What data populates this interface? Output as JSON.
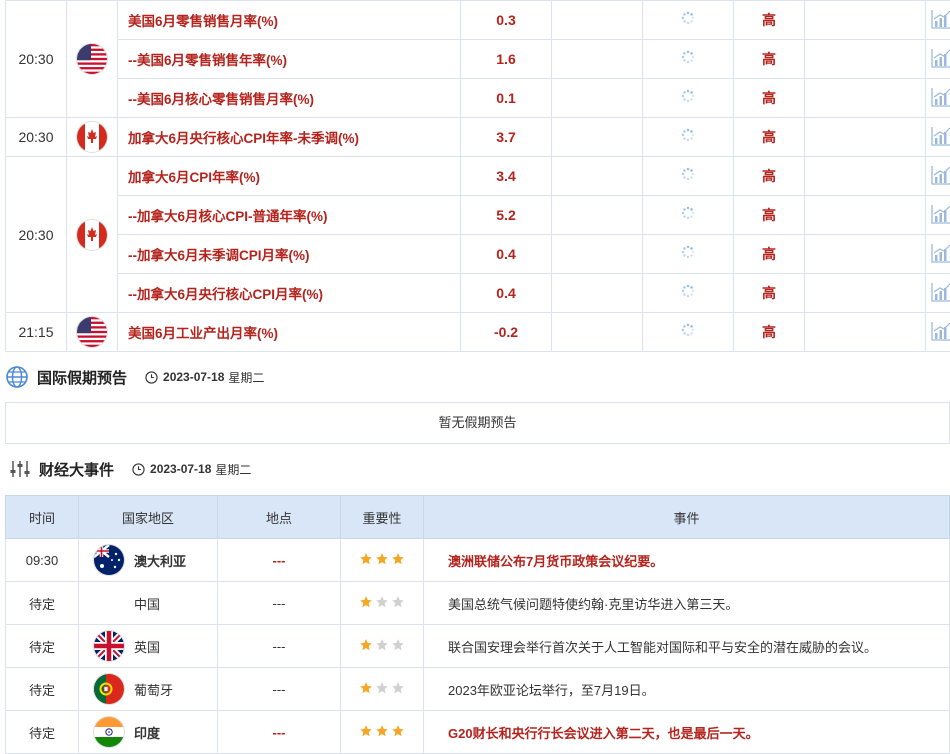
{
  "calendar": {
    "groups": [
      {
        "time": "20:30",
        "flag": "us-flag-icon",
        "rows": [
          {
            "event": "美国6月零售销售月率(%)",
            "value": "0.3",
            "importance": "高"
          },
          {
            "event": "--美国6月零售销售年率(%)",
            "value": "1.6",
            "importance": "高"
          },
          {
            "event": "--美国6月核心零售销售月率(%)",
            "value": "0.1",
            "importance": "高"
          }
        ]
      },
      {
        "time": "20:30",
        "flag": "ca-flag-icon",
        "rows": [
          {
            "event": "加拿大6月央行核心CPI年率-未季调(%)",
            "value": "3.7",
            "importance": "高"
          }
        ]
      },
      {
        "time": "20:30",
        "flag": "ca-flag-icon",
        "rows": [
          {
            "event": "加拿大6月CPI年率(%)",
            "value": "3.4",
            "importance": "高"
          },
          {
            "event": "--加拿大6月核心CPI-普通年率(%)",
            "value": "5.2",
            "importance": "高"
          },
          {
            "event": "--加拿大6月未季调CPI月率(%)",
            "value": "0.4",
            "importance": "高"
          },
          {
            "event": "--加拿大6月央行核心CPI月率(%)",
            "value": "0.4",
            "importance": "高"
          }
        ]
      },
      {
        "time": "21:15",
        "flag": "us-flag-icon",
        "rows": [
          {
            "event": "美国6月工业产出月率(%)",
            "value": "-0.2",
            "importance": "高"
          }
        ]
      }
    ]
  },
  "holiday": {
    "title": "国际假期预告",
    "date": "2023-07-18",
    "weekday": "星期二",
    "empty_text": "暂无假期预告"
  },
  "events": {
    "title": "财经大事件",
    "date": "2023-07-18",
    "weekday": "星期二",
    "headers": [
      "时间",
      "国家地区",
      "地点",
      "重要性",
      "事件"
    ],
    "rows": [
      {
        "time": "09:30",
        "country": "澳大利亚",
        "flag": "au-flag-icon",
        "place": "---",
        "stars": 3,
        "event": "澳洲联储公布7月货币政策会议纪要。"
      },
      {
        "time": "待定",
        "country": "中国",
        "flag": "",
        "place": "---",
        "stars": 1,
        "event": "美国总统气候问题特使约翰·克里访华进入第三天。"
      },
      {
        "time": "待定",
        "country": "英国",
        "flag": "uk-flag-icon",
        "place": "---",
        "stars": 1,
        "event": "联合国安理会举行首次关于人工智能对国际和平与安全的潜在威胁的会议。"
      },
      {
        "time": "待定",
        "country": "葡萄牙",
        "flag": "pt-flag-icon",
        "place": "---",
        "stars": 1,
        "event": "2023年欧亚论坛举行，至7月19日。"
      },
      {
        "time": "待定",
        "country": "印度",
        "flag": "in-flag-icon",
        "place": "---",
        "stars": 3,
        "event": "G20财长和央行行长会议进入第二天，也是最后一天。"
      }
    ]
  },
  "colors": {
    "accent": "#b5231d",
    "header_bg": "#d9e6f7",
    "border": "#dbe4ee",
    "star_on": "#f5a623",
    "star_off": "#d0d0d0"
  }
}
